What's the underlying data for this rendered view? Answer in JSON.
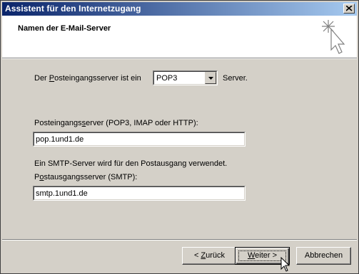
{
  "window": {
    "title": "Assistent für den Internetzugang"
  },
  "header": {
    "title": "Namen der E-Mail-Server"
  },
  "incoming_type": {
    "label_pre": "Der ",
    "label_underline": "P",
    "label_post": "osteingangsserver ist ein",
    "selected": "POP3",
    "suffix": "Server."
  },
  "incoming_server": {
    "label_pre": "Posteingangs",
    "label_underline": "s",
    "label_post": "erver (POP3, IMAP oder HTTP):",
    "value": "pop.1und1.de"
  },
  "smtp_note": "Ein SMTP-Server wird für den Postausgang verwendet.",
  "outgoing_server": {
    "label_pre": "P",
    "label_underline": "o",
    "label_post": "stausgangsserver (SMTP):",
    "value": "smtp.1und1.de"
  },
  "buttons": {
    "back_pre": "< ",
    "back_underline": "Z",
    "back_post": "urück",
    "next_underline": "W",
    "next_post": "eiter >",
    "cancel": "Abbrechen"
  }
}
